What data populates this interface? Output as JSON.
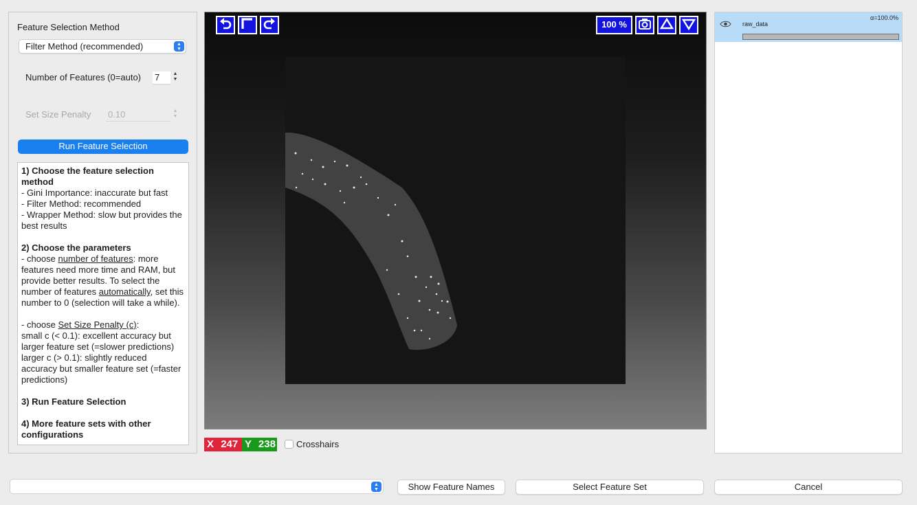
{
  "left_panel": {
    "title": "Feature Selection Method",
    "method_select": "Filter Method (recommended)",
    "num_features_label": "Number of Features (0=auto)",
    "num_features_value": "7",
    "set_size_penalty_label": "Set Size Penalty",
    "set_size_penalty_value": "0.10",
    "run_button": "Run Feature Selection"
  },
  "help": {
    "s1_title": "1) Choose the feature selection method",
    "s1_l1": "- Gini Importance: inaccurate but fast",
    "s1_l2": "- Filter Method: recommended",
    "s1_l3": "- Wrapper Method: slow but provides the best results",
    "s2_title": "2) Choose the parameters",
    "s2_a1": "- choose ",
    "s2_a_link": "number of features",
    "s2_a2": ": more features need more time and RAM, but provide better results. To select the number of features ",
    "s2_a_link2": "automatically",
    "s2_a3": ", set this number to 0 (selection will take a while).",
    "s2_b1": "- choose ",
    "s2_b_link": "Set Size Penalty (c)",
    "s2_b2": ":",
    "s2_b3": "small c (< 0.1): excellent accuracy but larger feature set (=slower predictions)",
    "s2_b4": "larger c (> 0.1): slightly reduced accuracy but smaller feature set (=faster predictions)",
    "s3_title": "3) Run Feature Selection",
    "s4_title": "4) More feature sets with other configurations"
  },
  "viewer": {
    "zoom_label": "100 %",
    "coord_x_label": "X",
    "coord_x_value": "247",
    "coord_y_label": "Y",
    "coord_y_value": "238",
    "crosshairs_label": "Crosshairs",
    "tool_icons": [
      "undo-icon",
      "fit-icon",
      "redo-icon",
      "camera-icon",
      "triangle-up-icon",
      "triangle-down-icon"
    ]
  },
  "layers": {
    "items": [
      {
        "name": "raw_data",
        "alpha": "α=100.0%",
        "opacity": 1.0
      }
    ]
  },
  "bottom": {
    "feature_set_select": "",
    "show_names_button": "Show Feature Names",
    "select_set_button": "Select Feature Set",
    "cancel_button": "Cancel"
  },
  "colors": {
    "accent_blue": "#1a7fef",
    "viewer_button": "#1313e0",
    "coord_x": "#e0243c",
    "coord_y": "#1a9a1a",
    "layer_selected": "#b8dbf8"
  }
}
